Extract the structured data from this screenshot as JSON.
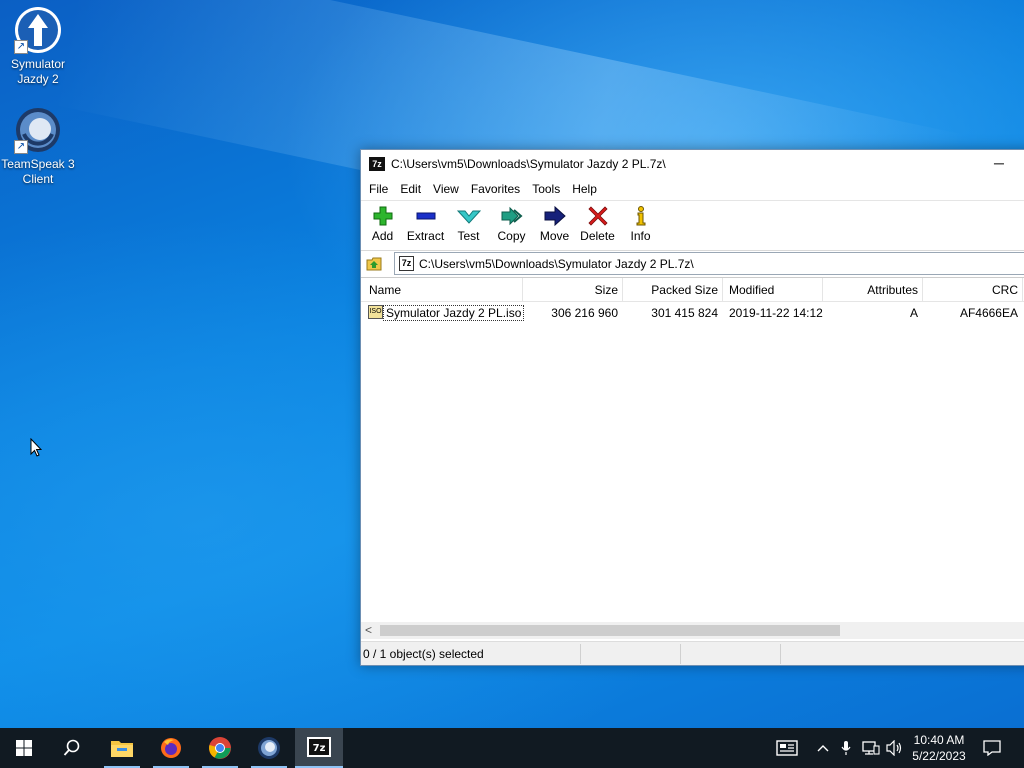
{
  "desktop": {
    "icons": [
      {
        "label": "Symulator Jazdy 2"
      },
      {
        "label": "TeamSpeak 3 Client"
      }
    ]
  },
  "window": {
    "title": "C:\\Users\\vm5\\Downloads\\Symulator Jazdy 2 PL.7z\\",
    "app_icon_text": "7z",
    "minimize_label": "─",
    "menu": [
      "File",
      "Edit",
      "View",
      "Favorites",
      "Tools",
      "Help"
    ],
    "toolbar": [
      {
        "label": "Add",
        "icon": "plus-icon"
      },
      {
        "label": "Extract",
        "icon": "minus-icon"
      },
      {
        "label": "Test",
        "icon": "check-icon"
      },
      {
        "label": "Copy",
        "icon": "double-arrow-icon"
      },
      {
        "label": "Move",
        "icon": "arrow-right-icon"
      },
      {
        "label": "Delete",
        "icon": "x-icon"
      },
      {
        "label": "Info",
        "icon": "info-icon"
      }
    ],
    "address": "C:\\Users\\vm5\\Downloads\\Symulator Jazdy 2 PL.7z\\",
    "columns": {
      "name": "Name",
      "size": "Size",
      "packed": "Packed Size",
      "modified": "Modified",
      "attributes": "Attributes",
      "crc": "CRC"
    },
    "files": [
      {
        "name": "Symulator Jazdy 2 PL.iso",
        "icon_text": "ISO",
        "size": "306 216 960",
        "packed": "301 415 824",
        "modified": "2019-11-22 14:12",
        "attributes": "A",
        "crc": "AF4666EA"
      }
    ],
    "status": "0 / 1 object(s) selected"
  },
  "taskbar": {
    "apps": [
      "start-icon",
      "search-icon",
      "file-explorer-icon",
      "firefox-icon",
      "chrome-icon",
      "teamspeak-icon",
      "7zip-icon"
    ],
    "clock_time": "10:40 AM",
    "clock_date": "5/22/2023"
  },
  "colors": {
    "desktop_blue": "#0a78d7",
    "taskbar": "#111a22",
    "add_green": "#2db52d",
    "extract_blue": "#1a2fc9",
    "test_teal": "#36c7c7",
    "delete_red": "#d81c1c",
    "info_yellow": "#f2c200"
  }
}
